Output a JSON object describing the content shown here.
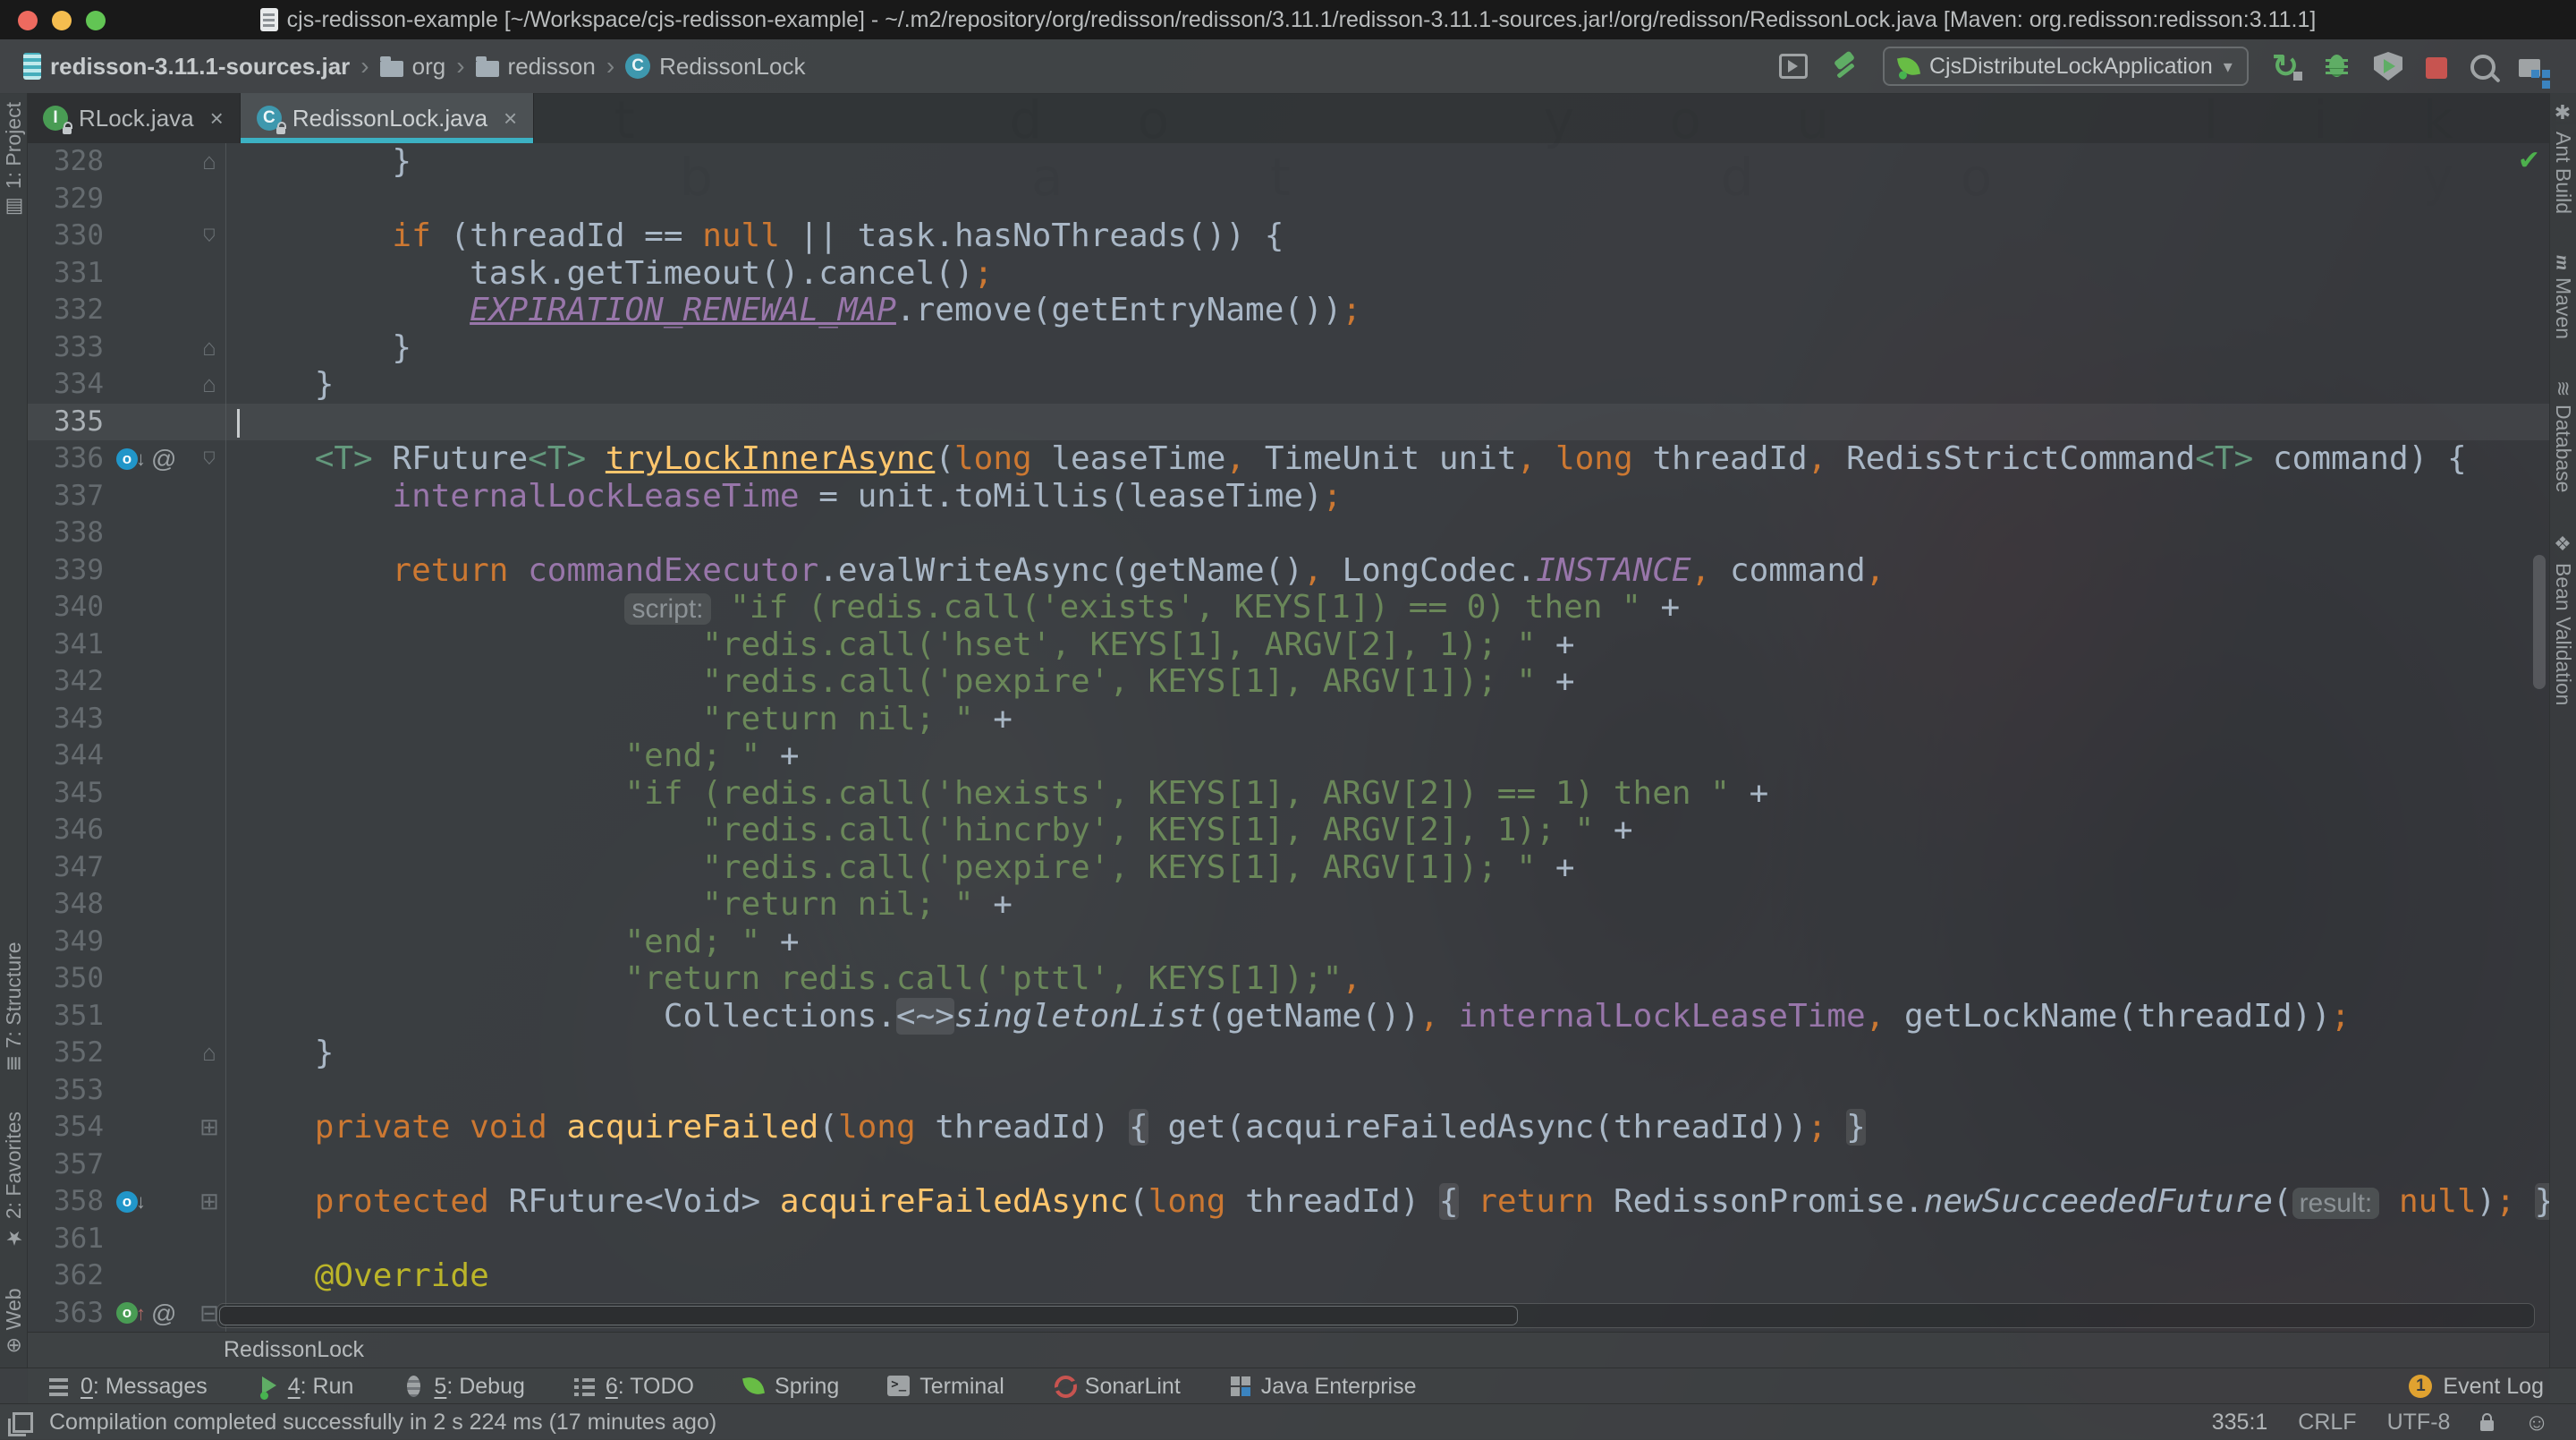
{
  "colors": {
    "tab_underline": "#3cb1c3",
    "keyword": "#cc7832",
    "string": "#6a8759",
    "field": "#9876aa",
    "method": "#ffc66d",
    "annotation": "#bbb529",
    "run_green": "#5fad65",
    "stop_red": "#c75450",
    "event_badge": "#e0a230"
  },
  "title_bar": {
    "title": "cjs-redisson-example [~/Workspace/cjs-redisson-example] - ~/.m2/repository/org/redisson/redisson/3.11.1/redisson-3.11.1-sources.jar!/org/redisson/RedissonLock.java [Maven: org.redisson:redisson:3.11.1]"
  },
  "wallpaper": {
    "row1": "a t      d o      y o u      l i k e",
    "row2": "b     a   t       d   o       y   o   u"
  },
  "toolbar": {
    "breadcrumbs": [
      {
        "label": "redisson-3.11.1-sources.jar",
        "icon": "jar"
      },
      {
        "label": "org",
        "icon": "folder"
      },
      {
        "label": "redisson",
        "icon": "folder"
      },
      {
        "label": "RedissonLock",
        "icon": "class"
      }
    ],
    "run_config": "CjsDistributeLockApplication",
    "class_letter": "C"
  },
  "tabs": [
    {
      "label": "RLock.java",
      "icon_letter": "I",
      "active": false,
      "close": "×"
    },
    {
      "label": "RedissonLock.java",
      "icon_letter": "C",
      "active": true,
      "close": "×"
    }
  ],
  "left_stripe": {
    "top": [
      {
        "label": "1: Project"
      }
    ],
    "bottom": [
      {
        "label": "7: Structure"
      },
      {
        "label": "2: Favorites"
      },
      {
        "label": "Web"
      }
    ]
  },
  "right_stripe": [
    {
      "label": "Ant Build"
    },
    {
      "label": "Maven"
    },
    {
      "label": "Database"
    },
    {
      "label": "Bean Validation"
    }
  ],
  "editor": {
    "breadcrumb": "RedissonLock",
    "caret_line": 335,
    "code": {
      "lines": [
        {
          "num": 328,
          "fold": "up",
          "tokens": [
            {
              "c": "d",
              "t": "        }"
            }
          ]
        },
        {
          "num": 329,
          "tokens": []
        },
        {
          "num": 330,
          "fold": "down",
          "tokens": [
            {
              "c": "d",
              "t": "        "
            },
            {
              "c": "k",
              "t": "if"
            },
            {
              "c": "d",
              "t": " (threadId == "
            },
            {
              "c": "k",
              "t": "null"
            },
            {
              "c": "d",
              "t": " || task.hasNoThreads()) {"
            }
          ]
        },
        {
          "num": 331,
          "tokens": [
            {
              "c": "d",
              "t": "            task.getTimeout().cancel()"
            },
            {
              "c": "k",
              "t": ";"
            }
          ]
        },
        {
          "num": 332,
          "tokens": [
            {
              "c": "d",
              "t": "            "
            },
            {
              "c": "fc",
              "t": "EXPIRATION_RENEWAL_MAP"
            },
            {
              "c": "d",
              "t": ".remove(getEntryName())"
            },
            {
              "c": "k",
              "t": ";"
            }
          ]
        },
        {
          "num": 333,
          "fold": "up",
          "tokens": [
            {
              "c": "d",
              "t": "        }"
            }
          ]
        },
        {
          "num": 334,
          "fold": "up",
          "tokens": [
            {
              "c": "d",
              "t": "    }"
            }
          ]
        },
        {
          "num": 335,
          "caret": true,
          "tokens": []
        },
        {
          "num": 336,
          "fold": "down",
          "icons": [
            "override",
            "annotation"
          ],
          "tokens": [
            {
              "c": "d",
              "t": "    "
            },
            {
              "c": "tp",
              "t": "<T>"
            },
            {
              "c": "d",
              "t": " RFuture"
            },
            {
              "c": "tp",
              "t": "<T>"
            },
            {
              "c": "d",
              "t": " "
            },
            {
              "c": "mu",
              "t": "tryLockInnerAsync"
            },
            {
              "c": "d",
              "t": "("
            },
            {
              "c": "k",
              "t": "long"
            },
            {
              "c": "d",
              "t": " leaseTime"
            },
            {
              "c": "k",
              "t": ","
            },
            {
              "c": "d",
              "t": " TimeUnit unit"
            },
            {
              "c": "k",
              "t": ","
            },
            {
              "c": "d",
              "t": " "
            },
            {
              "c": "k",
              "t": "long"
            },
            {
              "c": "d",
              "t": " threadId"
            },
            {
              "c": "k",
              "t": ","
            },
            {
              "c": "d",
              "t": " RedisStrictCommand"
            },
            {
              "c": "tp",
              "t": "<T>"
            },
            {
              "c": "d",
              "t": " command) {"
            }
          ]
        },
        {
          "num": 337,
          "tokens": [
            {
              "c": "d",
              "t": "        "
            },
            {
              "c": "f",
              "t": "internalLockLeaseTime"
            },
            {
              "c": "d",
              "t": " = unit.toMillis(leaseTime)"
            },
            {
              "c": "k",
              "t": ";"
            }
          ]
        },
        {
          "num": 338,
          "tokens": []
        },
        {
          "num": 339,
          "tokens": [
            {
              "c": "d",
              "t": "        "
            },
            {
              "c": "k",
              "t": "return"
            },
            {
              "c": "d",
              "t": " "
            },
            {
              "c": "f",
              "t": "commandExecutor"
            },
            {
              "c": "d",
              "t": ".evalWriteAsync(getName()"
            },
            {
              "c": "k",
              "t": ","
            },
            {
              "c": "d",
              "t": " LongCodec."
            },
            {
              "c": "fi",
              "t": "INSTANCE"
            },
            {
              "c": "k",
              "t": ","
            },
            {
              "c": "d",
              "t": " command"
            },
            {
              "c": "k",
              "t": ","
            }
          ]
        },
        {
          "num": 340,
          "tokens": [
            {
              "c": "d",
              "t": "                    "
            },
            {
              "c": "hint",
              "t": "script:"
            },
            {
              "c": "d",
              "t": " "
            },
            {
              "c": "s",
              "t": "\"if (redis.call('exists', KEYS[1]) == 0) then \""
            },
            {
              "c": "d",
              "t": " +"
            }
          ]
        },
        {
          "num": 341,
          "tokens": [
            {
              "c": "d",
              "t": "                        "
            },
            {
              "c": "s",
              "t": "\"redis.call('hset', KEYS[1], ARGV[2], 1); \""
            },
            {
              "c": "d",
              "t": " +"
            }
          ]
        },
        {
          "num": 342,
          "tokens": [
            {
              "c": "d",
              "t": "                        "
            },
            {
              "c": "s",
              "t": "\"redis.call('pexpire', KEYS[1], ARGV[1]); \""
            },
            {
              "c": "d",
              "t": " +"
            }
          ]
        },
        {
          "num": 343,
          "tokens": [
            {
              "c": "d",
              "t": "                        "
            },
            {
              "c": "s",
              "t": "\"return nil; \""
            },
            {
              "c": "d",
              "t": " +"
            }
          ]
        },
        {
          "num": 344,
          "tokens": [
            {
              "c": "d",
              "t": "                    "
            },
            {
              "c": "s",
              "t": "\"end; \""
            },
            {
              "c": "d",
              "t": " +"
            }
          ]
        },
        {
          "num": 345,
          "tokens": [
            {
              "c": "d",
              "t": "                    "
            },
            {
              "c": "s",
              "t": "\"if (redis.call('hexists', KEYS[1], ARGV[2]) == 1) then \""
            },
            {
              "c": "d",
              "t": " +"
            }
          ]
        },
        {
          "num": 346,
          "tokens": [
            {
              "c": "d",
              "t": "                        "
            },
            {
              "c": "s",
              "t": "\"redis.call('hincrby', KEYS[1], ARGV[2], 1); \""
            },
            {
              "c": "d",
              "t": " +"
            }
          ]
        },
        {
          "num": 347,
          "tokens": [
            {
              "c": "d",
              "t": "                        "
            },
            {
              "c": "s",
              "t": "\"redis.call('pexpire', KEYS[1], ARGV[1]); \""
            },
            {
              "c": "d",
              "t": " +"
            }
          ]
        },
        {
          "num": 348,
          "tokens": [
            {
              "c": "d",
              "t": "                        "
            },
            {
              "c": "s",
              "t": "\"return nil; \""
            },
            {
              "c": "d",
              "t": " +"
            }
          ]
        },
        {
          "num": 349,
          "tokens": [
            {
              "c": "d",
              "t": "                    "
            },
            {
              "c": "s",
              "t": "\"end; \""
            },
            {
              "c": "d",
              "t": " +"
            }
          ]
        },
        {
          "num": 350,
          "tokens": [
            {
              "c": "d",
              "t": "                    "
            },
            {
              "c": "s",
              "t": "\"return redis.call('pttl', KEYS[1]);\""
            },
            {
              "c": "k",
              "t": ","
            }
          ]
        },
        {
          "num": 351,
          "tokens": [
            {
              "c": "d",
              "t": "                      Collections."
            },
            {
              "c": "fold",
              "t": "<~>"
            },
            {
              "c": "it",
              "t": "singletonList"
            },
            {
              "c": "d",
              "t": "(getName())"
            },
            {
              "c": "k",
              "t": ","
            },
            {
              "c": "d",
              "t": " "
            },
            {
              "c": "f",
              "t": "internalLockLeaseTime"
            },
            {
              "c": "k",
              "t": ","
            },
            {
              "c": "d",
              "t": " getLockName(threadId))"
            },
            {
              "c": "k",
              "t": ";"
            }
          ]
        },
        {
          "num": 352,
          "fold": "up",
          "tokens": [
            {
              "c": "d",
              "t": "    }"
            }
          ]
        },
        {
          "num": 353,
          "tokens": []
        },
        {
          "num": 354,
          "fold": "plus",
          "tokens": [
            {
              "c": "d",
              "t": "    "
            },
            {
              "c": "k",
              "t": "private"
            },
            {
              "c": "d",
              "t": " "
            },
            {
              "c": "k",
              "t": "void"
            },
            {
              "c": "d",
              "t": " "
            },
            {
              "c": "m",
              "t": "acquireFailed"
            },
            {
              "c": "d",
              "t": "("
            },
            {
              "c": "k",
              "t": "long"
            },
            {
              "c": "d",
              "t": " threadId) "
            },
            {
              "c": "fold",
              "t": "{"
            },
            {
              "c": "d",
              "t": " get(acquireFailedAsync(threadId))"
            },
            {
              "c": "k",
              "t": ";"
            },
            {
              "c": "d",
              "t": " "
            },
            {
              "c": "fold",
              "t": "}"
            }
          ]
        },
        {
          "num": 357,
          "tokens": []
        },
        {
          "num": 358,
          "fold": "plus",
          "icons": [
            "override"
          ],
          "tokens": [
            {
              "c": "d",
              "t": "    "
            },
            {
              "c": "k",
              "t": "protected"
            },
            {
              "c": "d",
              "t": " RFuture<Void> "
            },
            {
              "c": "m",
              "t": "acquireFailedAsync"
            },
            {
              "c": "d",
              "t": "("
            },
            {
              "c": "k",
              "t": "long"
            },
            {
              "c": "d",
              "t": " threadId) "
            },
            {
              "c": "fold",
              "t": "{"
            },
            {
              "c": "d",
              "t": " "
            },
            {
              "c": "k",
              "t": "return"
            },
            {
              "c": "d",
              "t": " RedissonPromise."
            },
            {
              "c": "it",
              "t": "newSucceededFuture"
            },
            {
              "c": "d",
              "t": "("
            },
            {
              "c": "hint",
              "t": "result:"
            },
            {
              "c": "d",
              "t": " "
            },
            {
              "c": "k",
              "t": "null"
            },
            {
              "c": "d",
              "t": ")"
            },
            {
              "c": "k",
              "t": ";"
            },
            {
              "c": "d",
              "t": " "
            },
            {
              "c": "fold",
              "t": "}"
            }
          ]
        },
        {
          "num": 361,
          "tokens": []
        },
        {
          "num": 362,
          "tokens": [
            {
              "c": "d",
              "t": "    "
            },
            {
              "c": "a",
              "t": "@Override"
            }
          ]
        },
        {
          "num": 363,
          "icons": [
            "implements",
            "annotation"
          ],
          "fold": "minus",
          "tokens": []
        }
      ]
    }
  },
  "bottom_bar": {
    "items": [
      {
        "name": "toolwindow-messages",
        "icon": "messages",
        "label": "0: Messages",
        "mnemonic": "0"
      },
      {
        "name": "toolwindow-run",
        "icon": "run",
        "label": "4: Run",
        "mnemonic": "4"
      },
      {
        "name": "toolwindow-debug",
        "icon": "debug",
        "label": "5: Debug",
        "mnemonic": "5"
      },
      {
        "name": "toolwindow-todo",
        "icon": "todo",
        "label": "6: TODO",
        "mnemonic": "6"
      },
      {
        "name": "toolwindow-spring",
        "icon": "spring",
        "label": "Spring"
      },
      {
        "name": "toolwindow-terminal",
        "icon": "terminal",
        "label": "Terminal"
      },
      {
        "name": "toolwindow-sonarlint",
        "icon": "sonarlint",
        "label": "SonarLint"
      },
      {
        "name": "toolwindow-java-enterprise",
        "icon": "javaee",
        "label": "Java Enterprise"
      }
    ],
    "event_log_badge": "1",
    "event_log_label": "Event Log"
  },
  "status_bar": {
    "message": "Compilation completed successfully in 2 s 224 ms (17 minutes ago)",
    "position": "335:1",
    "line_separator": "CRLF",
    "encoding": "UTF-8"
  }
}
